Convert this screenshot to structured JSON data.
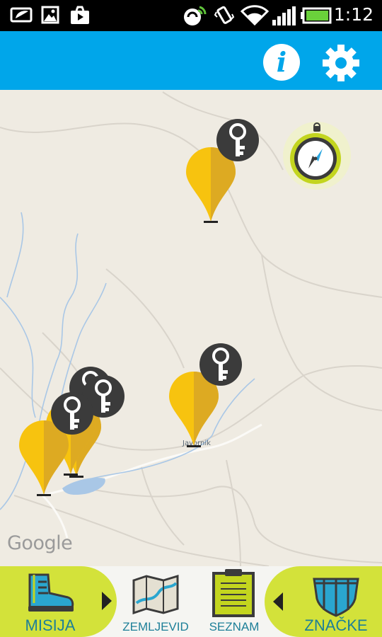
{
  "status_bar": {
    "time": "1:12",
    "icons": [
      "battery-saver-icon",
      "image-icon",
      "media-icon",
      "sync-icon",
      "vibrate-icon",
      "wifi-icon",
      "signal-icon",
      "battery-icon"
    ]
  },
  "app_bar": {
    "color": "#00a6ea",
    "info_glyph": "i",
    "icons": [
      "info-icon",
      "gear-icon"
    ]
  },
  "map": {
    "attribution": "Google",
    "place_label": "Javornik",
    "compass_icon": "compass-icon",
    "marker_count": 5,
    "marker_icon": "key-icon",
    "marker_color": "#f7c30f"
  },
  "bottom_nav": {
    "accent_color": "#d3e23a",
    "text_color": "#1d7f98",
    "tabs": [
      {
        "label": "MISIJA",
        "icon": "hiking-boot-icon"
      },
      {
        "label": "ZEMLJEVID",
        "icon": "map-icon"
      },
      {
        "label": "SEZNAM",
        "icon": "clipboard-icon"
      },
      {
        "label": "ZNAČKE",
        "icon": "badge-icon"
      }
    ]
  }
}
